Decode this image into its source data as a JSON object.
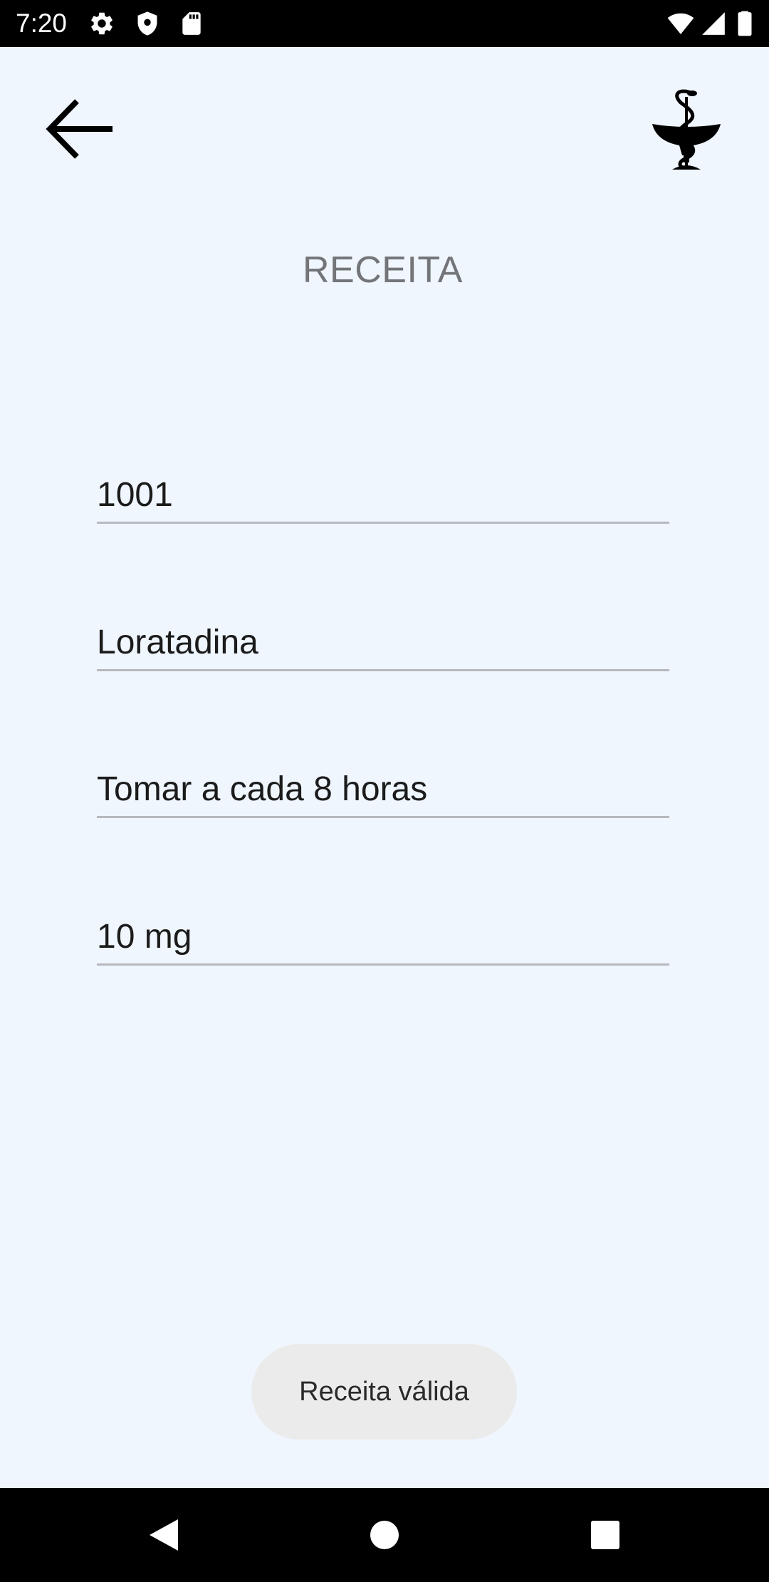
{
  "status_bar": {
    "time": "7:20",
    "left_icons": [
      "gear-icon",
      "shield-icon",
      "sd-card-icon"
    ],
    "right_icons": [
      "wifi-icon",
      "signal-icon",
      "battery-icon"
    ]
  },
  "header": {
    "back_icon": "arrow-left-icon",
    "logo_icon": "bowl-of-hygieia-icon"
  },
  "page": {
    "title": "RECEITA"
  },
  "form": {
    "fields": [
      {
        "value": "1001"
      },
      {
        "value": "Loratadina"
      },
      {
        "value": "Tomar a cada 8 horas"
      },
      {
        "value": "10 mg"
      }
    ]
  },
  "toast": {
    "message": "Receita válida"
  },
  "nav_bar": {
    "icons": [
      "back-triangle-icon",
      "home-circle-icon",
      "recents-square-icon"
    ]
  },
  "colors": {
    "background": "#eff6fe",
    "title": "#737579",
    "field_underline": "#b7b9bd",
    "toast_background": "#ebebeb",
    "system_bars": "#000000"
  }
}
